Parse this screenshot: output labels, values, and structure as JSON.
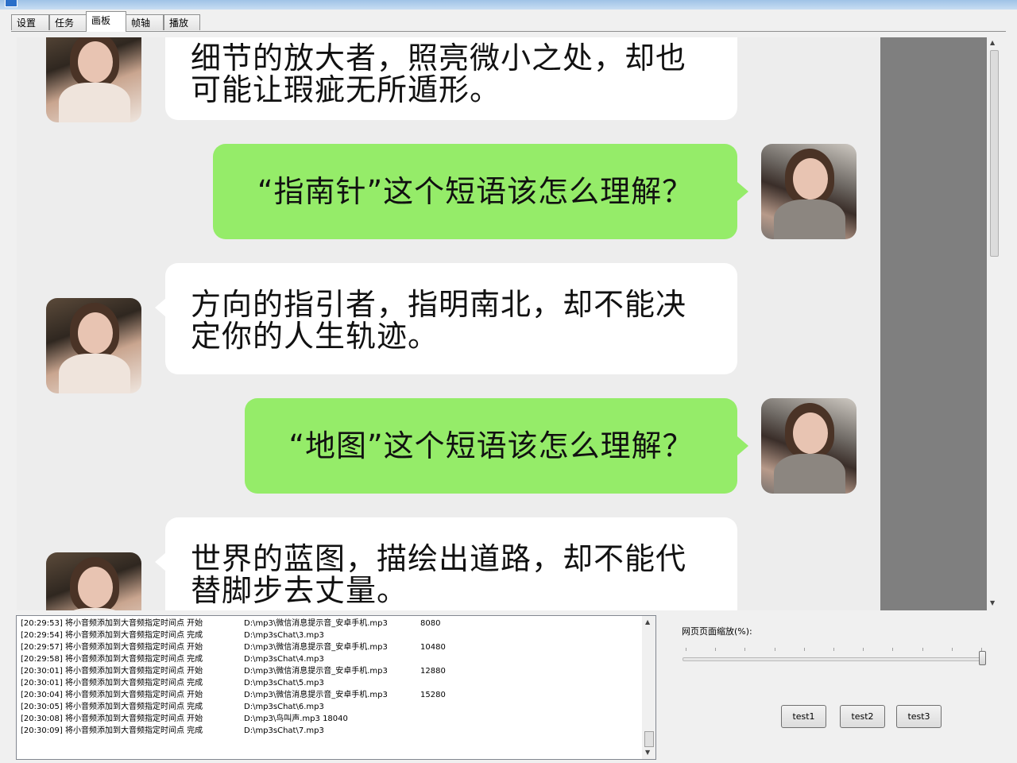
{
  "tabs": [
    {
      "label": "设置"
    },
    {
      "label": "任务"
    },
    {
      "label": "画板"
    },
    {
      "label": "帧轴"
    },
    {
      "label": "播放"
    }
  ],
  "active_tab": "画板",
  "chat": {
    "messages": [
      {
        "side": "left",
        "lines": [
          "细节的放大者，照亮微小之处，却也",
          "可能让瑕疵无所遁形。"
        ]
      },
      {
        "side": "right",
        "lines": [
          "“指南针”这个短语该怎么理解？"
        ]
      },
      {
        "side": "left",
        "lines": [
          "方向的指引者，指明南北，却不能决",
          "定你的人生轨迹。"
        ]
      },
      {
        "side": "right",
        "lines": [
          "“地图”这个短语该怎么理解？"
        ]
      },
      {
        "side": "left",
        "lines": [
          "世界的蓝图，描绘出道路，却不能代",
          "替脚步去丈量。"
        ]
      }
    ],
    "bubble_colors": {
      "left": "#ffffff",
      "right": "#95ec69"
    },
    "background": "#ededed"
  },
  "log": {
    "lines": [
      {
        "time": "[20:29:53]",
        "msg": "将小音频添加到大音频指定时间点 开始",
        "path": "D:\\mp3\\微信消息提示音_安卓手机.mp3",
        "val": "8080"
      },
      {
        "time": "[20:29:54]",
        "msg": "将小音频添加到大音频指定时间点 完成",
        "path": "D:\\mp3sChat\\3.mp3",
        "val": ""
      },
      {
        "time": "[20:29:57]",
        "msg": "将小音频添加到大音频指定时间点 开始",
        "path": "D:\\mp3\\微信消息提示音_安卓手机.mp3",
        "val": "10480"
      },
      {
        "time": "[20:29:58]",
        "msg": "将小音频添加到大音频指定时间点 完成",
        "path": "D:\\mp3sChat\\4.mp3",
        "val": ""
      },
      {
        "time": "[20:30:01]",
        "msg": "将小音频添加到大音频指定时间点 开始",
        "path": "D:\\mp3\\微信消息提示音_安卓手机.mp3",
        "val": "12880"
      },
      {
        "time": "[20:30:01]",
        "msg": "将小音频添加到大音频指定时间点 完成",
        "path": "D:\\mp3sChat\\5.mp3",
        "val": ""
      },
      {
        "time": "[20:30:04]",
        "msg": "将小音频添加到大音频指定时间点 开始",
        "path": "D:\\mp3\\微信消息提示音_安卓手机.mp3",
        "val": "15280"
      },
      {
        "time": "[20:30:05]",
        "msg": "将小音频添加到大音频指定时间点 完成",
        "path": "D:\\mp3sChat\\6.mp3",
        "val": ""
      },
      {
        "time": "[20:30:08]",
        "msg": "将小音频添加到大音频指定时间点 开始",
        "path": "D:\\mp3\\鸟叫声.mp3 18040",
        "val": ""
      },
      {
        "time": "[20:30:09]",
        "msg": "将小音频添加到大音频指定时间点 完成",
        "path": "D:\\mp3sChat\\7.mp3",
        "val": ""
      }
    ]
  },
  "zoom": {
    "label": "网页页面缩放(%):",
    "level_fraction": 1.0
  },
  "buttons": [
    {
      "label": "test1"
    },
    {
      "label": "test2"
    },
    {
      "label": "test3"
    }
  ]
}
